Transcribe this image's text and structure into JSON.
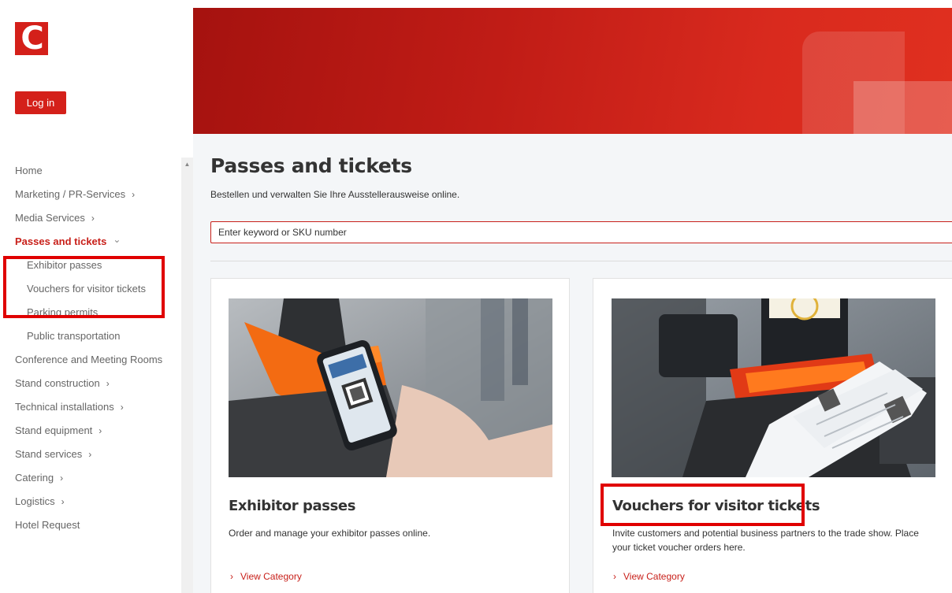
{
  "logo": {
    "letter": "C"
  },
  "header": {
    "login_label": "Log in"
  },
  "sidebar": {
    "items": [
      {
        "label": "Home",
        "chevron": ""
      },
      {
        "label": "Marketing / PR-Services",
        "chevron": "›"
      },
      {
        "label": "Media Services",
        "chevron": "›"
      },
      {
        "label": "Passes and tickets",
        "chevron": "⌄"
      },
      {
        "label": "Exhibitor passes",
        "chevron": ""
      },
      {
        "label": "Vouchers for visitor tickets",
        "chevron": ""
      },
      {
        "label": "Parking permits",
        "chevron": ""
      },
      {
        "label": "Public transportation",
        "chevron": ""
      },
      {
        "label": "Conference and Meeting Rooms",
        "chevron": ""
      },
      {
        "label": "Stand construction",
        "chevron": "›"
      },
      {
        "label": "Technical installations",
        "chevron": "›"
      },
      {
        "label": "Stand equipment",
        "chevron": "›"
      },
      {
        "label": "Stand services",
        "chevron": "›"
      },
      {
        "label": "Catering",
        "chevron": "›"
      },
      {
        "label": "Logistics",
        "chevron": "›"
      },
      {
        "label": "Hotel Request",
        "chevron": ""
      }
    ]
  },
  "main": {
    "title": "Passes and tickets",
    "subtitle": "Bestellen und verwalten Sie Ihre Ausstellerausweise online.",
    "search_placeholder": "Enter keyword or SKU number",
    "cards": [
      {
        "title": "Exhibitor passes",
        "description": "Order and manage your exhibitor passes online.",
        "link_label": "View Category"
      },
      {
        "title": "Vouchers for visitor tickets",
        "description": "Invite customers and potential business partners to the trade show. Place your ticket voucher orders here.",
        "link_label": "View Category"
      }
    ]
  },
  "colors": {
    "brand": "#d4201a",
    "highlight": "#e00000",
    "link": "#c8201a"
  }
}
